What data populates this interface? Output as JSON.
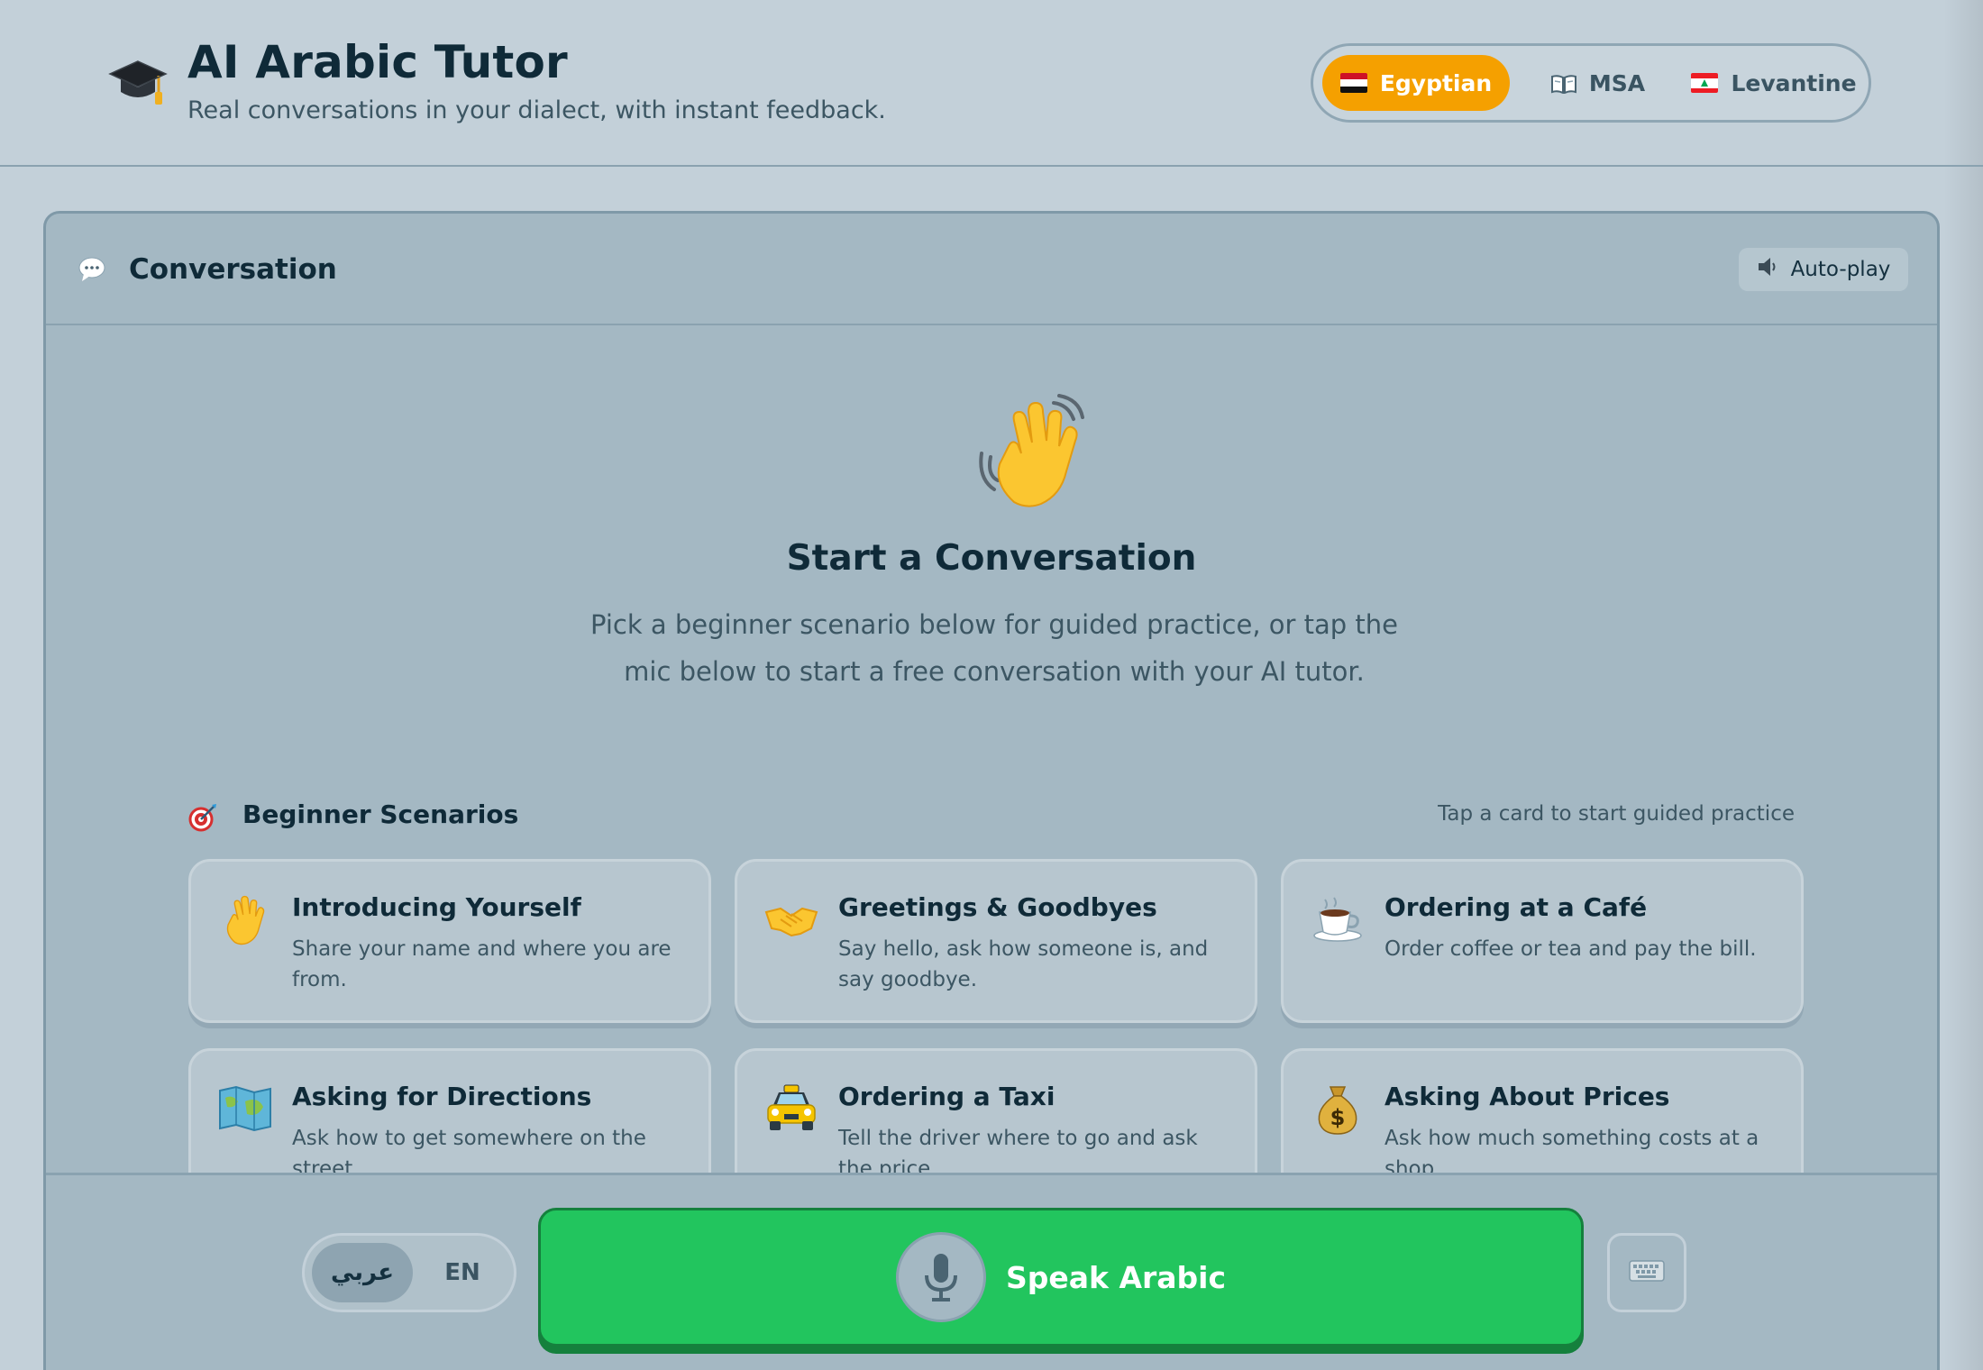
{
  "header": {
    "title": "AI Arabic Tutor",
    "subtitle": "Real conversations in your dialect, with instant feedback.",
    "logo_icon": "graduation-cap-icon"
  },
  "dialects": {
    "selected": "Egyptian",
    "options": [
      {
        "label": "Egyptian",
        "icon": "egypt-flag-icon"
      },
      {
        "label": "MSA",
        "icon": "book-icon"
      },
      {
        "label": "Levantine",
        "icon": "lebanon-flag-icon"
      }
    ]
  },
  "conversation": {
    "title": "Conversation",
    "icon": "speech-bubble-icon",
    "autoplay_label": "Auto-play",
    "autoplay_icon": "speaker-icon"
  },
  "empty_state": {
    "icon": "waving-hand-icon",
    "title": "Start a Conversation",
    "description": "Pick a beginner scenario below for guided practice, or tap the mic below to start a free conversation with your AI tutor."
  },
  "scenarios": {
    "icon": "target-icon",
    "title": "Beginner Scenarios",
    "hint": "Tap a card to start guided practice",
    "items": [
      {
        "title": "Introducing Yourself",
        "description": "Share your name and where you are from.",
        "icon": "waving-hand-icon"
      },
      {
        "title": "Greetings & Goodbyes",
        "description": "Say hello, ask how someone is, and say goodbye.",
        "icon": "handshake-icon"
      },
      {
        "title": "Ordering at a Café",
        "description": "Order coffee or tea and pay the bill.",
        "icon": "coffee-cup-icon"
      },
      {
        "title": "Asking for Directions",
        "description": "Ask how to get somewhere on the street.",
        "icon": "map-icon"
      },
      {
        "title": "Ordering a Taxi",
        "description": "Tell the driver where to go and ask the price.",
        "icon": "taxi-icon"
      },
      {
        "title": "Asking About Prices",
        "description": "Ask how much something costs at a shop.",
        "icon": "money-bag-icon"
      }
    ]
  },
  "input_bar": {
    "language_options": [
      "عربي",
      "EN"
    ],
    "selected_language": "عربي",
    "speak_label": "Speak Arabic",
    "mic_icon": "microphone-icon",
    "keyboard_icon": "keyboard-icon"
  },
  "colors": {
    "accent_orange": "#f5a000",
    "speak_green": "#22c55e",
    "background": "#c3d0d9",
    "panel": "#a4b8c3"
  }
}
